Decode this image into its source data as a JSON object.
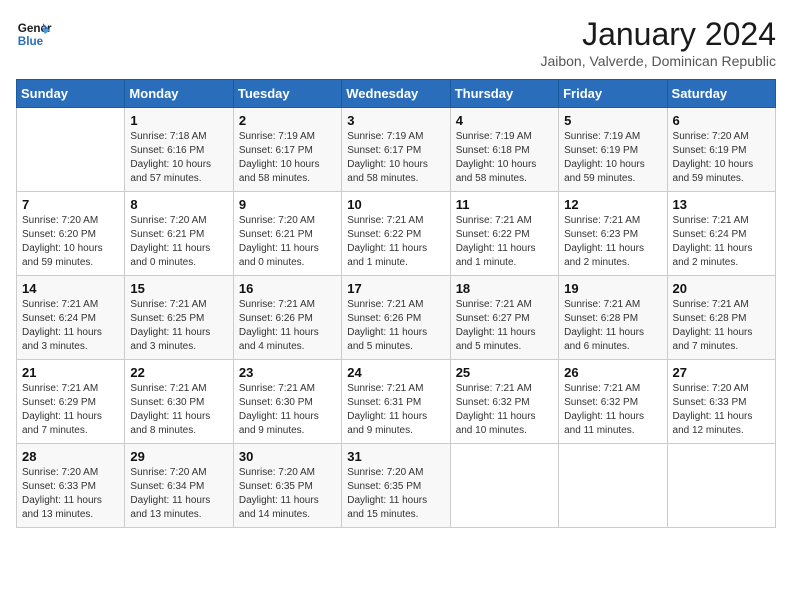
{
  "header": {
    "logo_line1": "General",
    "logo_line2": "Blue",
    "month": "January 2024",
    "location": "Jaibon, Valverde, Dominican Republic"
  },
  "days_of_week": [
    "Sunday",
    "Monday",
    "Tuesday",
    "Wednesday",
    "Thursday",
    "Friday",
    "Saturday"
  ],
  "weeks": [
    [
      {
        "num": "",
        "info": ""
      },
      {
        "num": "1",
        "info": "Sunrise: 7:18 AM\nSunset: 6:16 PM\nDaylight: 10 hours and 57 minutes."
      },
      {
        "num": "2",
        "info": "Sunrise: 7:19 AM\nSunset: 6:17 PM\nDaylight: 10 hours and 58 minutes."
      },
      {
        "num": "3",
        "info": "Sunrise: 7:19 AM\nSunset: 6:17 PM\nDaylight: 10 hours and 58 minutes."
      },
      {
        "num": "4",
        "info": "Sunrise: 7:19 AM\nSunset: 6:18 PM\nDaylight: 10 hours and 58 minutes."
      },
      {
        "num": "5",
        "info": "Sunrise: 7:19 AM\nSunset: 6:19 PM\nDaylight: 10 hours and 59 minutes."
      },
      {
        "num": "6",
        "info": "Sunrise: 7:20 AM\nSunset: 6:19 PM\nDaylight: 10 hours and 59 minutes."
      }
    ],
    [
      {
        "num": "7",
        "info": "Sunrise: 7:20 AM\nSunset: 6:20 PM\nDaylight: 10 hours and 59 minutes."
      },
      {
        "num": "8",
        "info": "Sunrise: 7:20 AM\nSunset: 6:21 PM\nDaylight: 11 hours and 0 minutes."
      },
      {
        "num": "9",
        "info": "Sunrise: 7:20 AM\nSunset: 6:21 PM\nDaylight: 11 hours and 0 minutes."
      },
      {
        "num": "10",
        "info": "Sunrise: 7:21 AM\nSunset: 6:22 PM\nDaylight: 11 hours and 1 minute."
      },
      {
        "num": "11",
        "info": "Sunrise: 7:21 AM\nSunset: 6:22 PM\nDaylight: 11 hours and 1 minute."
      },
      {
        "num": "12",
        "info": "Sunrise: 7:21 AM\nSunset: 6:23 PM\nDaylight: 11 hours and 2 minutes."
      },
      {
        "num": "13",
        "info": "Sunrise: 7:21 AM\nSunset: 6:24 PM\nDaylight: 11 hours and 2 minutes."
      }
    ],
    [
      {
        "num": "14",
        "info": "Sunrise: 7:21 AM\nSunset: 6:24 PM\nDaylight: 11 hours and 3 minutes."
      },
      {
        "num": "15",
        "info": "Sunrise: 7:21 AM\nSunset: 6:25 PM\nDaylight: 11 hours and 3 minutes."
      },
      {
        "num": "16",
        "info": "Sunrise: 7:21 AM\nSunset: 6:26 PM\nDaylight: 11 hours and 4 minutes."
      },
      {
        "num": "17",
        "info": "Sunrise: 7:21 AM\nSunset: 6:26 PM\nDaylight: 11 hours and 5 minutes."
      },
      {
        "num": "18",
        "info": "Sunrise: 7:21 AM\nSunset: 6:27 PM\nDaylight: 11 hours and 5 minutes."
      },
      {
        "num": "19",
        "info": "Sunrise: 7:21 AM\nSunset: 6:28 PM\nDaylight: 11 hours and 6 minutes."
      },
      {
        "num": "20",
        "info": "Sunrise: 7:21 AM\nSunset: 6:28 PM\nDaylight: 11 hours and 7 minutes."
      }
    ],
    [
      {
        "num": "21",
        "info": "Sunrise: 7:21 AM\nSunset: 6:29 PM\nDaylight: 11 hours and 7 minutes."
      },
      {
        "num": "22",
        "info": "Sunrise: 7:21 AM\nSunset: 6:30 PM\nDaylight: 11 hours and 8 minutes."
      },
      {
        "num": "23",
        "info": "Sunrise: 7:21 AM\nSunset: 6:30 PM\nDaylight: 11 hours and 9 minutes."
      },
      {
        "num": "24",
        "info": "Sunrise: 7:21 AM\nSunset: 6:31 PM\nDaylight: 11 hours and 9 minutes."
      },
      {
        "num": "25",
        "info": "Sunrise: 7:21 AM\nSunset: 6:32 PM\nDaylight: 11 hours and 10 minutes."
      },
      {
        "num": "26",
        "info": "Sunrise: 7:21 AM\nSunset: 6:32 PM\nDaylight: 11 hours and 11 minutes."
      },
      {
        "num": "27",
        "info": "Sunrise: 7:20 AM\nSunset: 6:33 PM\nDaylight: 11 hours and 12 minutes."
      }
    ],
    [
      {
        "num": "28",
        "info": "Sunrise: 7:20 AM\nSunset: 6:33 PM\nDaylight: 11 hours and 13 minutes."
      },
      {
        "num": "29",
        "info": "Sunrise: 7:20 AM\nSunset: 6:34 PM\nDaylight: 11 hours and 13 minutes."
      },
      {
        "num": "30",
        "info": "Sunrise: 7:20 AM\nSunset: 6:35 PM\nDaylight: 11 hours and 14 minutes."
      },
      {
        "num": "31",
        "info": "Sunrise: 7:20 AM\nSunset: 6:35 PM\nDaylight: 11 hours and 15 minutes."
      },
      {
        "num": "",
        "info": ""
      },
      {
        "num": "",
        "info": ""
      },
      {
        "num": "",
        "info": ""
      }
    ]
  ]
}
